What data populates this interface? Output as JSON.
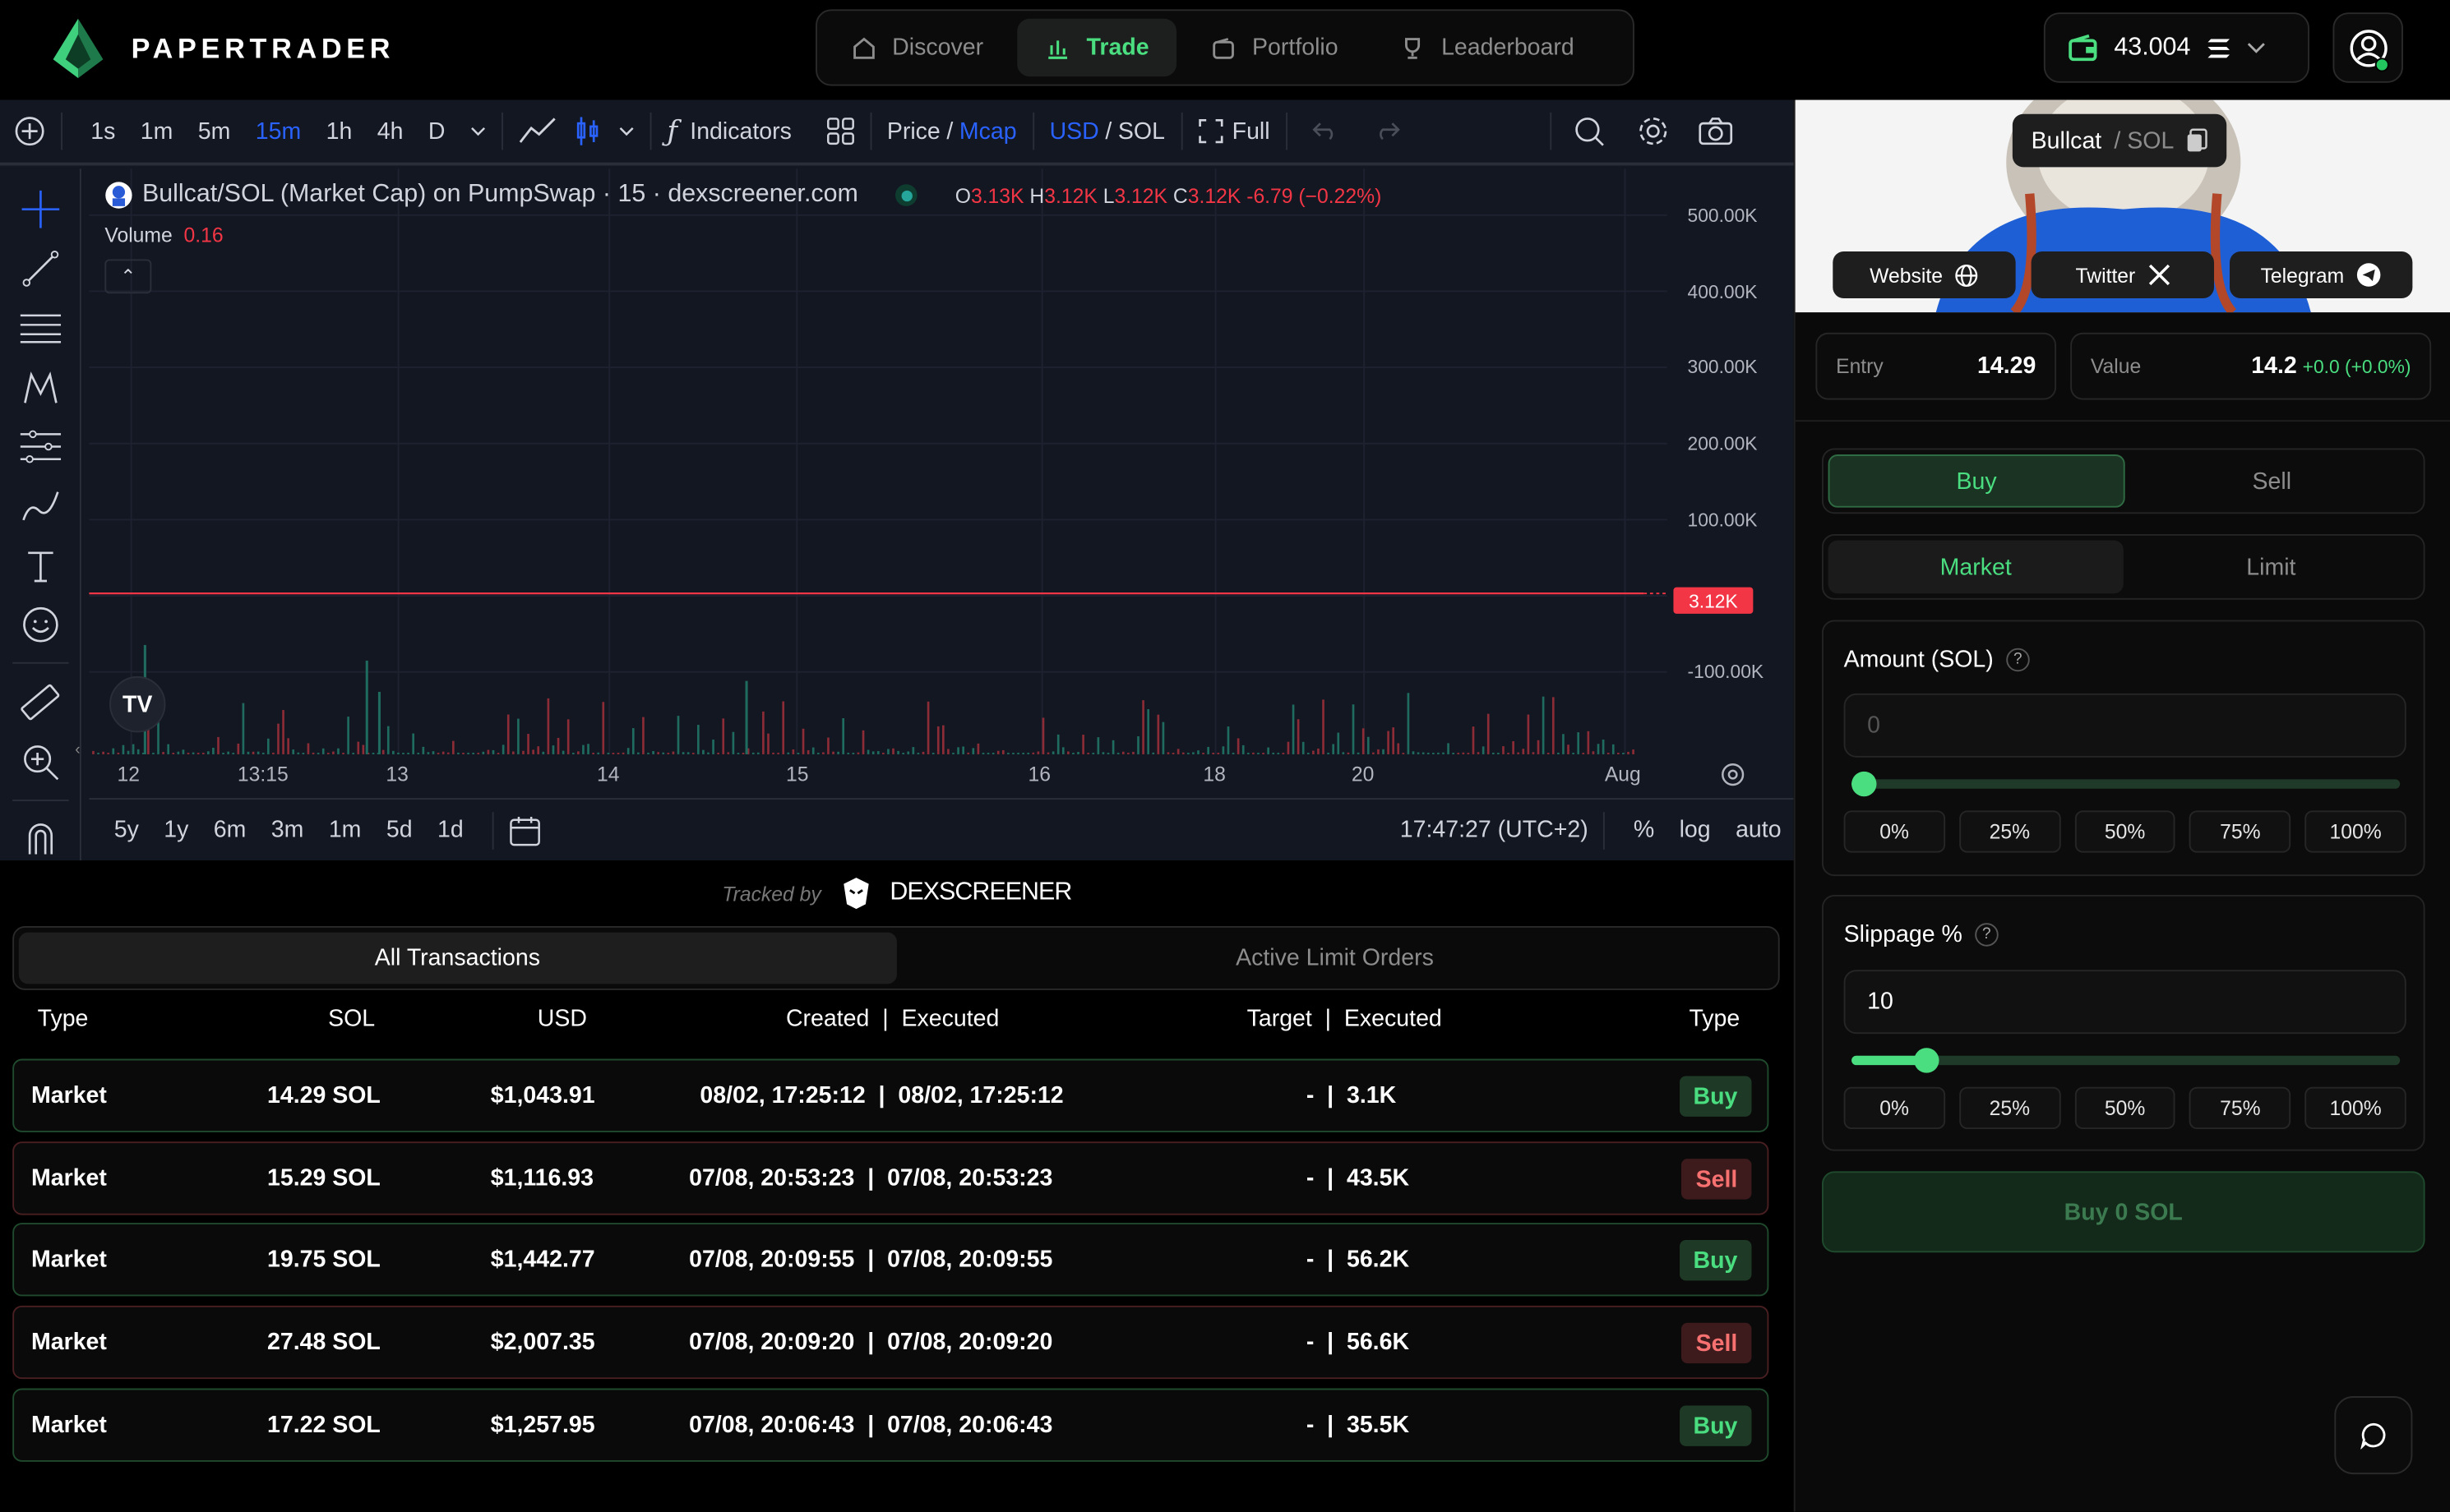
{
  "app": {
    "brand": "PAPERTRADER",
    "nav": [
      {
        "label": "Discover"
      },
      {
        "label": "Trade"
      },
      {
        "label": "Portfolio"
      },
      {
        "label": "Leaderboard"
      }
    ],
    "wallet_balance": "43.004"
  },
  "chart_toolbar": {
    "timeframes": [
      "1s",
      "1m",
      "5m",
      "15m",
      "1h",
      "4h",
      "D"
    ],
    "active_timeframe": "15m",
    "indicators_label": "Indicators",
    "price_label": "Price",
    "mcap_label": "Mcap",
    "usd_label": "USD",
    "sol_label": "SOL",
    "full_label": "Full",
    "slash": "/"
  },
  "chart_data": {
    "type": "line",
    "title": "Bullcat/SOL (Market Cap) on PumpSwap · 15 · dexscreener.com",
    "ohlc": {
      "o": "3.13K",
      "h": "3.12K",
      "l": "3.12K",
      "c": "3.12K",
      "change": "-6.79 (−0.22%)"
    },
    "volume_label": "Volume",
    "volume_value": "0.16",
    "y_tick_labels": [
      "500.00K",
      "400.00K",
      "300.00K",
      "200.00K",
      "100.00K",
      "-100.00K"
    ],
    "x_tick_labels": [
      "12",
      "13:15",
      "13",
      "14",
      "15",
      "16",
      "18",
      "20",
      "Aug"
    ],
    "last_price_label": "3.12K",
    "series": [
      {
        "values": [
          3.13,
          3.13,
          3.12,
          3.12,
          3.12,
          3.12,
          3.12,
          3.12,
          3.12
        ]
      }
    ],
    "ylim": [
      -120,
      520
    ],
    "line_color": "#f23645"
  },
  "range_bar": {
    "ranges": [
      "5y",
      "1y",
      "6m",
      "3m",
      "1m",
      "5d",
      "1d"
    ],
    "time": "17:47:27 (UTC+2)",
    "pct": "%",
    "log": "log",
    "auto": "auto"
  },
  "tracked": {
    "prefix": "Tracked by",
    "brand": "DEXSCREENER"
  },
  "tx_tabs": {
    "all": "All Transactions",
    "limit": "Active Limit Orders"
  },
  "table": {
    "headers": {
      "type": "Type",
      "sol": "SOL",
      "usd": "USD",
      "created": "Created  |  Executed",
      "target": "Target  |  Executed",
      "type2": "Type"
    },
    "rows": [
      {
        "type": "Market",
        "sol": "14.29 SOL",
        "usd": "$1,043.91",
        "created": "08/02, 17:25:12  |  08/02, 17:25:12",
        "target": "-  |  3.1K",
        "side": "Buy"
      },
      {
        "type": "Market",
        "sol": "15.29 SOL",
        "usd": "$1,116.93",
        "created": "07/08, 20:53:23  |  07/08, 20:53:23",
        "target": "-  |  43.5K",
        "side": "Sell"
      },
      {
        "type": "Market",
        "sol": "19.75 SOL",
        "usd": "$1,442.77",
        "created": "07/08, 20:09:55  |  07/08, 20:09:55",
        "target": "-  |  56.2K",
        "side": "Buy"
      },
      {
        "type": "Market",
        "sol": "27.48 SOL",
        "usd": "$2,007.35",
        "created": "07/08, 20:09:20  |  07/08, 20:09:20",
        "target": "-  |  56.6K",
        "side": "Sell"
      },
      {
        "type": "Market",
        "sol": "17.22 SOL",
        "usd": "$1,257.95",
        "created": "07/08, 20:06:43  |  07/08, 20:06:43",
        "target": "-  |  35.5K",
        "side": "Buy"
      }
    ]
  },
  "panel": {
    "token": "Bullcat",
    "quote": "/ SOL",
    "socials": [
      "Website",
      "Twitter",
      "Telegram"
    ],
    "entry_label": "Entry",
    "entry_value": "14.29",
    "value_label": "Value",
    "value_value": "14.2",
    "value_change": "+0.0 (+0.0%)",
    "side_buy": "Buy",
    "side_sell": "Sell",
    "order_market": "Market",
    "order_limit": "Limit",
    "amount_label": "Amount (SOL)",
    "amount_placeholder": "0",
    "amount_fraction": 0,
    "pcts": [
      "0%",
      "25%",
      "50%",
      "75%",
      "100%"
    ],
    "slippage_label": "Slippage %",
    "slippage_value": "10",
    "slippage_fraction": 0.12,
    "buy_button": "Buy 0 SOL",
    "help": "?"
  }
}
